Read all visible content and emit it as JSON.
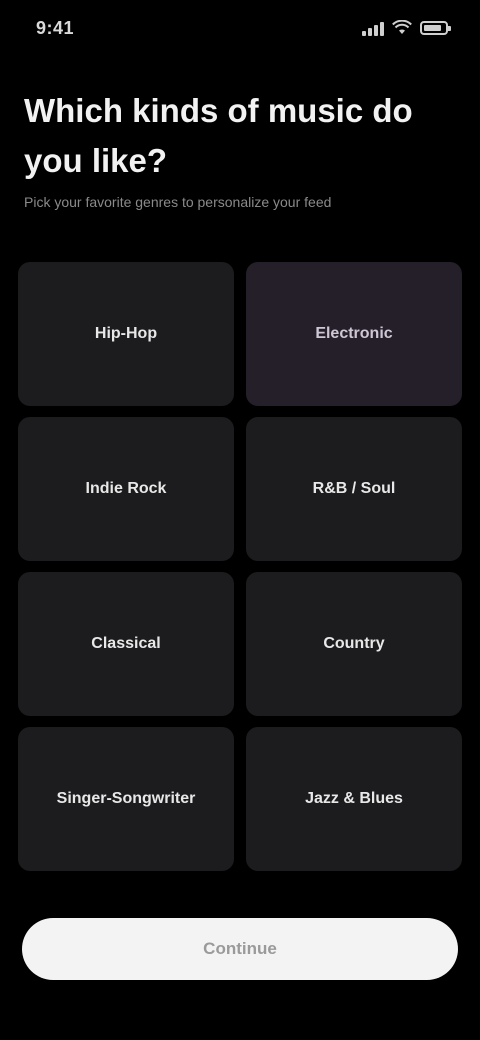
{
  "status_bar": {
    "time": "9:41",
    "icons": [
      "cellular-signal-icon",
      "wifi-icon",
      "battery-icon"
    ]
  },
  "header": {
    "title": "Which kinds of music do you like?",
    "subtitle": "Pick your favorite genres to personalize your feed"
  },
  "genres": [
    {
      "label": "Hip-Hop",
      "selected": false
    },
    {
      "label": "Electronic",
      "selected": true
    },
    {
      "label": "Indie Rock",
      "selected": false
    },
    {
      "label": "R&B / Soul",
      "selected": false
    },
    {
      "label": "Classical",
      "selected": false
    },
    {
      "label": "Country",
      "selected": false
    },
    {
      "label": "Singer-Songwriter",
      "selected": false
    },
    {
      "label": "Jazz & Blues",
      "selected": false
    }
  ],
  "footer": {
    "continue_label": "Continue"
  },
  "colors": {
    "background": "#000000",
    "tile": "#1c1c1e",
    "tile_selected": "#241f29",
    "button": "#f3f3f3",
    "button_text": "#9a9a9a"
  }
}
